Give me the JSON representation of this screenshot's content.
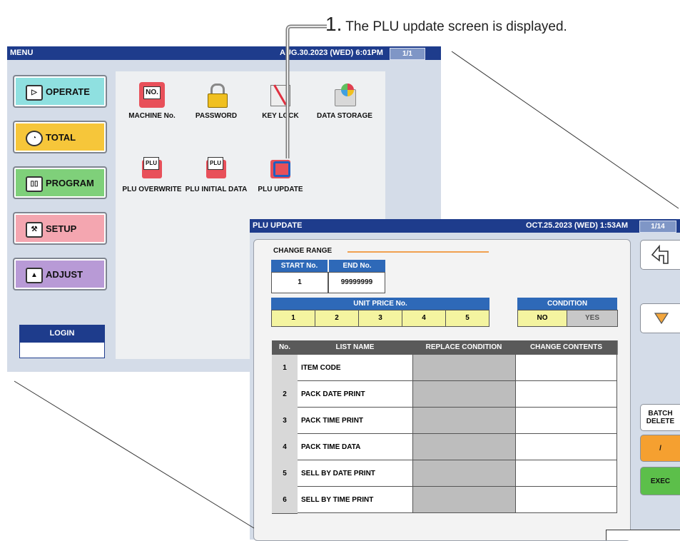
{
  "callout": {
    "number": "1.",
    "text": " The PLU update screen is displayed."
  },
  "menu_screen": {
    "title": "MENU",
    "datetime": "AUG.30.2023 (WED)  6:01PM",
    "page": "1/1",
    "buttons": [
      {
        "label": "OPERATE",
        "icon": "play-icon",
        "color": "#8fe0e0"
      },
      {
        "label": "TOTAL",
        "icon": "clock-icon",
        "color": "#f6c63a"
      },
      {
        "label": "PROGRAM",
        "icon": "book-icon",
        "color": "#7fd07a"
      },
      {
        "label": "SETUP",
        "icon": "wrench-icon",
        "color": "#f4a6b0"
      },
      {
        "label": "ADJUST",
        "icon": "scale-icon",
        "color": "#b89ad6"
      }
    ],
    "items": [
      {
        "label": "MACHINE No.",
        "icon": "machine-number-icon"
      },
      {
        "label": "PASSWORD",
        "icon": "padlock-icon"
      },
      {
        "label": "KEY LOCK",
        "icon": "key-lock-icon"
      },
      {
        "label": "DATA STORAGE",
        "icon": "data-storage-icon"
      },
      {
        "label": "PLU OVERWRITE",
        "icon": "plu-overwrite-icon"
      },
      {
        "label": "PLU INITIAL DATA",
        "icon": "plu-initial-data-icon"
      },
      {
        "label": "PLU UPDATE",
        "icon": "plu-update-icon"
      }
    ],
    "login_label": "LOGIN",
    "login_value": ""
  },
  "plu_screen": {
    "title": "PLU UPDATE",
    "datetime": "OCT.25.2023 (WED)  1:53AM",
    "page": "1/14",
    "change_range_label": "CHANGE RANGE",
    "start_label": "START No.",
    "start_value": "1",
    "end_label": "END No.",
    "end_value": "99999999",
    "unit_price_label": "UNIT PRICE No.",
    "unit_prices": [
      "1",
      "2",
      "3",
      "4",
      "5"
    ],
    "condition_label": "CONDITION",
    "condition_options": [
      "NO",
      "YES"
    ],
    "condition_selected": "NO",
    "table_headers": [
      "No.",
      "LIST NAME",
      "REPLACE CONDITION",
      "CHANGE CONTENTS"
    ],
    "rows": [
      {
        "no": "1",
        "name": "ITEM CODE"
      },
      {
        "no": "2",
        "name": "PACK DATE PRINT"
      },
      {
        "no": "3",
        "name": "PACK TIME PRINT"
      },
      {
        "no": "4",
        "name": "PACK TIME DATA"
      },
      {
        "no": "5",
        "name": "SELL BY DATE PRINT"
      },
      {
        "no": "6",
        "name": "SELL BY TIME PRINT"
      }
    ],
    "side_buttons": {
      "back_icon": "return-arrow-icon",
      "down_icon": "triangle-down-icon",
      "batch_delete_line1": "BATCH",
      "batch_delete_line2": "DELETE",
      "slash": "/",
      "exec": "EXEC"
    },
    "colors": {
      "title_bar": "#1e3c8c",
      "header_blue": "#2e69b8",
      "unit_price_yellow": "#f4f4a0",
      "exec_green": "#5cbf4a",
      "slash_orange": "#f5a030"
    }
  }
}
